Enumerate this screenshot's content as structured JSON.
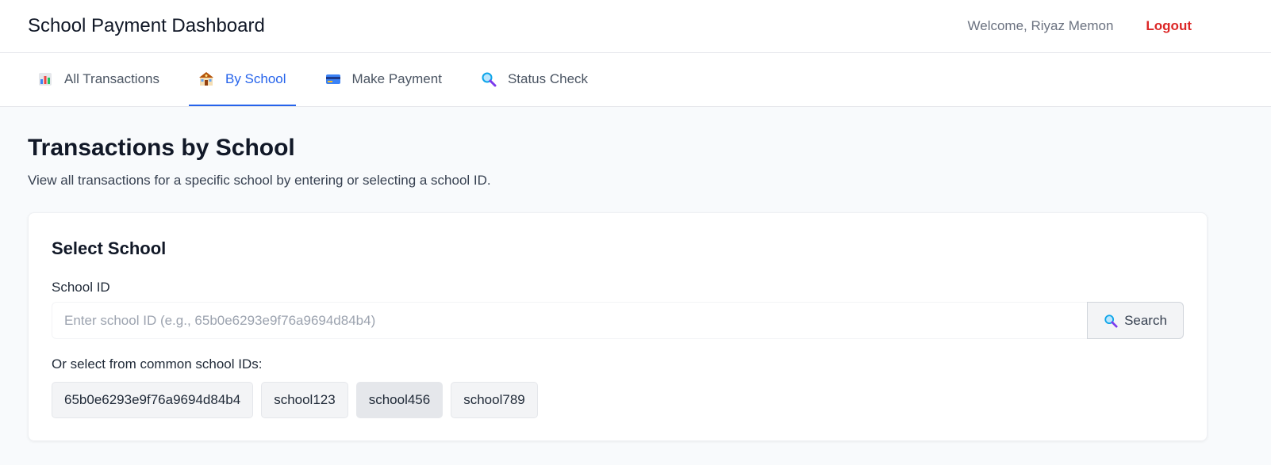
{
  "header": {
    "title": "School Payment Dashboard",
    "welcome": "Welcome, Riyaz Memon",
    "logout": "Logout"
  },
  "tabs": [
    {
      "label": "All Transactions",
      "icon": "bar-chart-icon",
      "active": false
    },
    {
      "label": "By School",
      "icon": "school-icon",
      "active": true
    },
    {
      "label": "Make Payment",
      "icon": "credit-card-icon",
      "active": false
    },
    {
      "label": "Status Check",
      "icon": "magnifier-icon",
      "active": false
    }
  ],
  "main": {
    "title": "Transactions by School",
    "description": "View all transactions for a specific school by entering or selecting a school ID."
  },
  "card": {
    "title": "Select School",
    "field_label": "School ID",
    "input_placeholder": "Enter school ID (e.g., 65b0e6293e9f76a9694d84b4)",
    "input_value": "",
    "search_label": "Search",
    "common_label": "Or select from common school IDs:",
    "chips": [
      "65b0e6293e9f76a9694d84b4",
      "school123",
      "school456",
      "school789"
    ]
  },
  "colors": {
    "accent": "#2563eb",
    "logout": "#dc2626",
    "background": "#f8fafc"
  }
}
